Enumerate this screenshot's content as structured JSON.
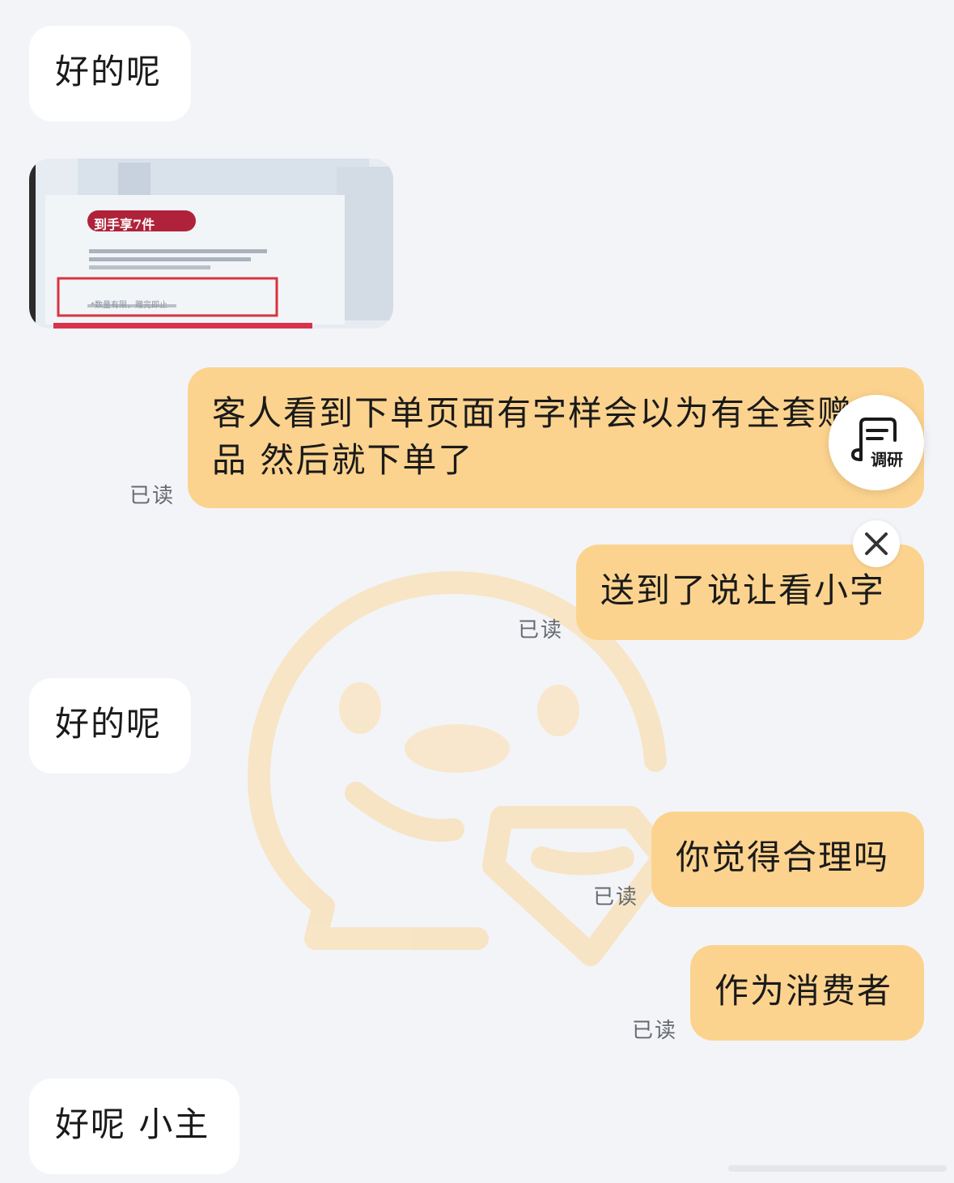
{
  "messages": [
    {
      "side": "in",
      "text": "好的呢"
    },
    {
      "side": "in",
      "type": "image",
      "image": {
        "badge": "到手享7件",
        "footnote": "*数量有限，赠完即止"
      }
    },
    {
      "side": "out",
      "lines": [
        "客人看到下单页面有字样会以为有全套赠",
        "品 然后就下单了"
      ],
      "status": "已读"
    },
    {
      "side": "out",
      "text": "送到了说让看小字",
      "status": "已读"
    },
    {
      "side": "in",
      "text": "好的呢"
    },
    {
      "side": "out",
      "text": "你觉得合理吗",
      "status": "已读"
    },
    {
      "side": "out",
      "text": "作为消费者",
      "status": "已读"
    },
    {
      "side": "in",
      "text": "好呢 小主"
    }
  ],
  "research_button": {
    "label": "调研",
    "icon": "survey-icon"
  },
  "close_button": {
    "icon": "close-icon"
  },
  "colors": {
    "background": "#f3f4f8",
    "incoming_bubble": "#ffffff",
    "outgoing_bubble": "#fcd38e",
    "read_status": "#666a70"
  }
}
